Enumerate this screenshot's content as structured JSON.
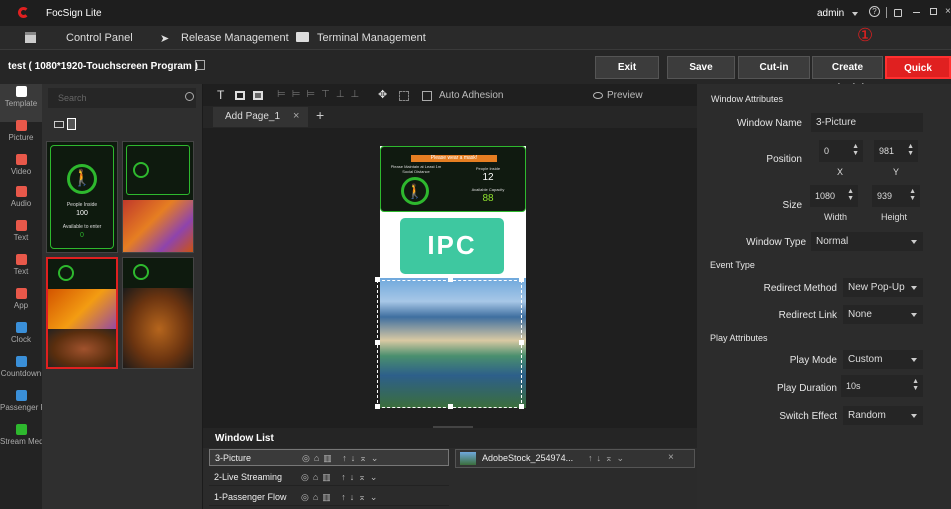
{
  "app": {
    "name": "FocSign Lite",
    "user": "admin"
  },
  "nav": {
    "control_panel": "Control Panel",
    "release_management": "Release Management",
    "terminal_management": "Terminal Management"
  },
  "toolbar": {
    "program_title": "test ( 1080*1920-Touchscreen Program )",
    "exit": "Exit",
    "save": "Save",
    "cut_in": "Cut-in Program",
    "create_schedule": "Create Schedule",
    "quick_release": "Quick Release",
    "step_marker": "①"
  },
  "rail": [
    {
      "label": "Template"
    },
    {
      "label": "Picture"
    },
    {
      "label": "Video"
    },
    {
      "label": "Audio"
    },
    {
      "label": "Text"
    },
    {
      "label": "Text"
    },
    {
      "label": "App"
    },
    {
      "label": "Clock"
    },
    {
      "label": "Countdown"
    },
    {
      "label": "Passenger Fl"
    },
    {
      "label": "Stream Med"
    }
  ],
  "template_panel": {
    "search_placeholder": "Search"
  },
  "editor": {
    "auto_adhesion": "Auto Adhesion",
    "preview": "Preview",
    "tab": "Add Page_1"
  },
  "canvas_content": {
    "banner": "Please wear a mask!",
    "notice": "Please Maintain at Least 1m Social Distance",
    "people_inside_label": "People Inside",
    "people_inside": "12",
    "capacity_label": "Available Capacity",
    "capacity": "88",
    "ipc": "IPC"
  },
  "template_thumb": {
    "people_inside_label": "People Inside",
    "people_inside": "100",
    "available": "Available to enter",
    "available_value": "0"
  },
  "window_list": {
    "title": "Window List",
    "rows": [
      {
        "name": "3-Picture"
      },
      {
        "name": "2-Live Streaming"
      },
      {
        "name": "1-Passenger Flow"
      }
    ],
    "media_item": "AdobeStock_254974..."
  },
  "attributes": {
    "window_title": "Window Attributes",
    "window_name_label": "Window Name",
    "window_name": "3-Picture",
    "position_label": "Position",
    "pos_x": "0",
    "pos_y": "981",
    "x_label": "X",
    "y_label": "Y",
    "size_label": "Size",
    "width": "1080",
    "height": "939",
    "width_label": "Width",
    "height_label": "Height",
    "window_type_label": "Window Type",
    "window_type": "Normal",
    "event_title": "Event Type",
    "redirect_method_label": "Redirect Method",
    "redirect_method": "New Pop-Up",
    "redirect_link_label": "Redirect Link",
    "redirect_link": "None",
    "play_title": "Play Attributes",
    "play_mode_label": "Play Mode",
    "play_mode": "Custom",
    "play_duration_label": "Play Duration",
    "play_duration": "10s",
    "switch_effect_label": "Switch Effect",
    "switch_effect": "Random"
  },
  "colors": {
    "accent_red": "#e02020",
    "rail_icon": "#e8584a",
    "green": "#2eb82e",
    "teal": "#3ec8a0"
  }
}
